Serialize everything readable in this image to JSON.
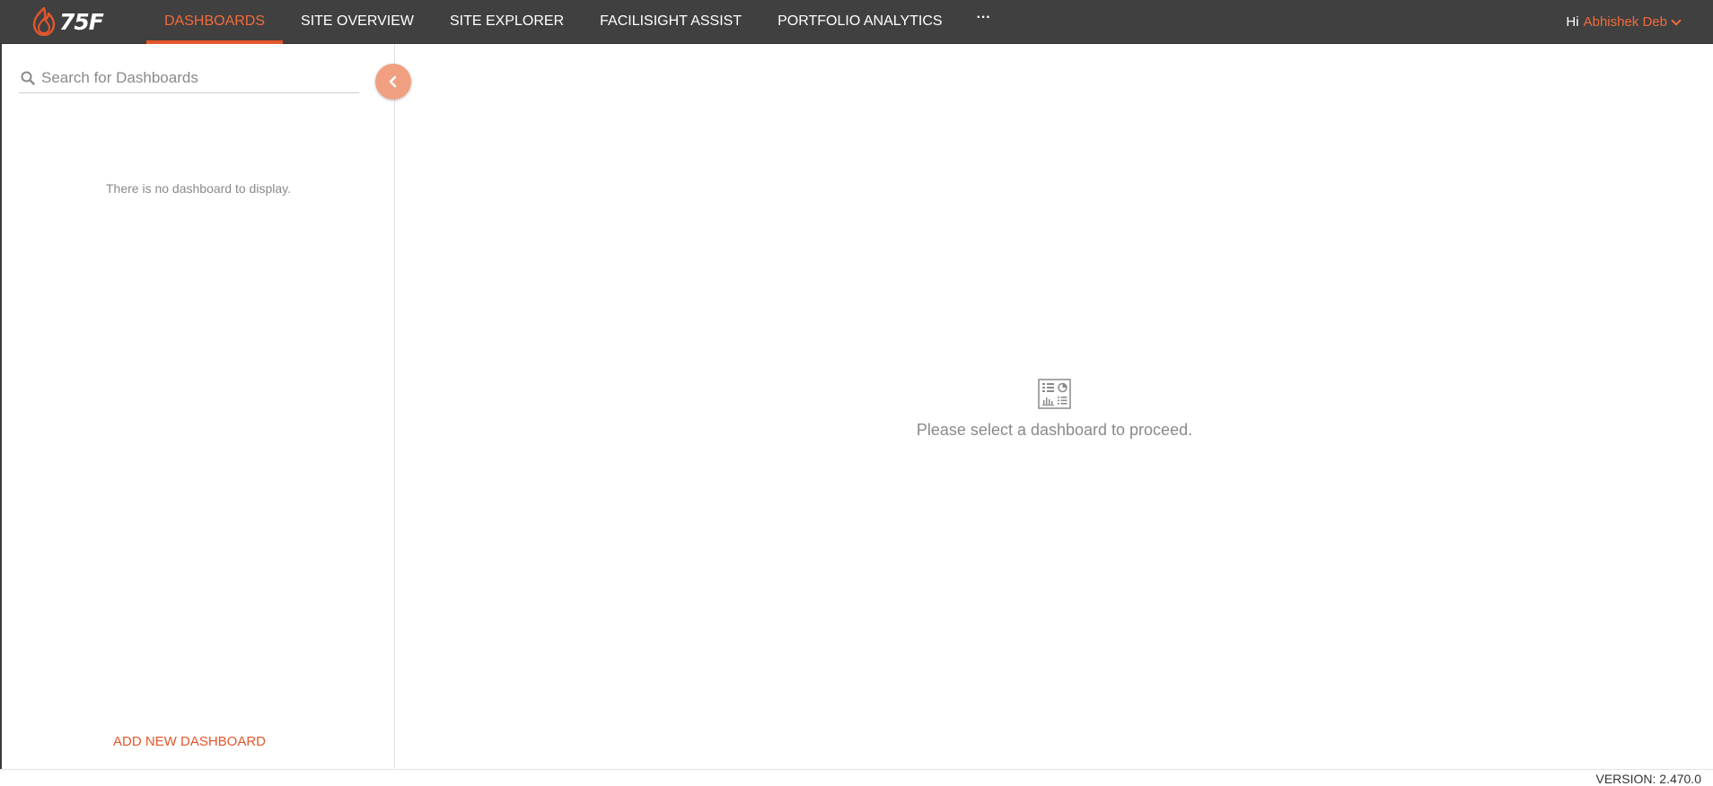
{
  "brand": {
    "logo_text": "75F",
    "accent_color": "#e5562b",
    "topbar_color": "#404040"
  },
  "nav": {
    "tabs": [
      {
        "label": "DASHBOARDS",
        "active": true
      },
      {
        "label": "SITE OVERVIEW",
        "active": false
      },
      {
        "label": "SITE EXPLORER",
        "active": false
      },
      {
        "label": "FACILISIGHT ASSIST",
        "active": false
      },
      {
        "label": "PORTFOLIO ANALYTICS",
        "active": false
      }
    ],
    "more_label": "···"
  },
  "user": {
    "greeting": "Hi",
    "name": "Abhishek Deb"
  },
  "sidebar": {
    "search_placeholder": "Search for Dashboards",
    "search_value": "",
    "empty_message": "There is no dashboard to display.",
    "add_button_label": "ADD NEW DASHBOARD",
    "collapse_icon": "chevron-left-icon"
  },
  "main": {
    "icon": "dashboard-icon",
    "message": "Please select a dashboard to proceed."
  },
  "footer": {
    "version": "VERSION: 2.470.0"
  }
}
